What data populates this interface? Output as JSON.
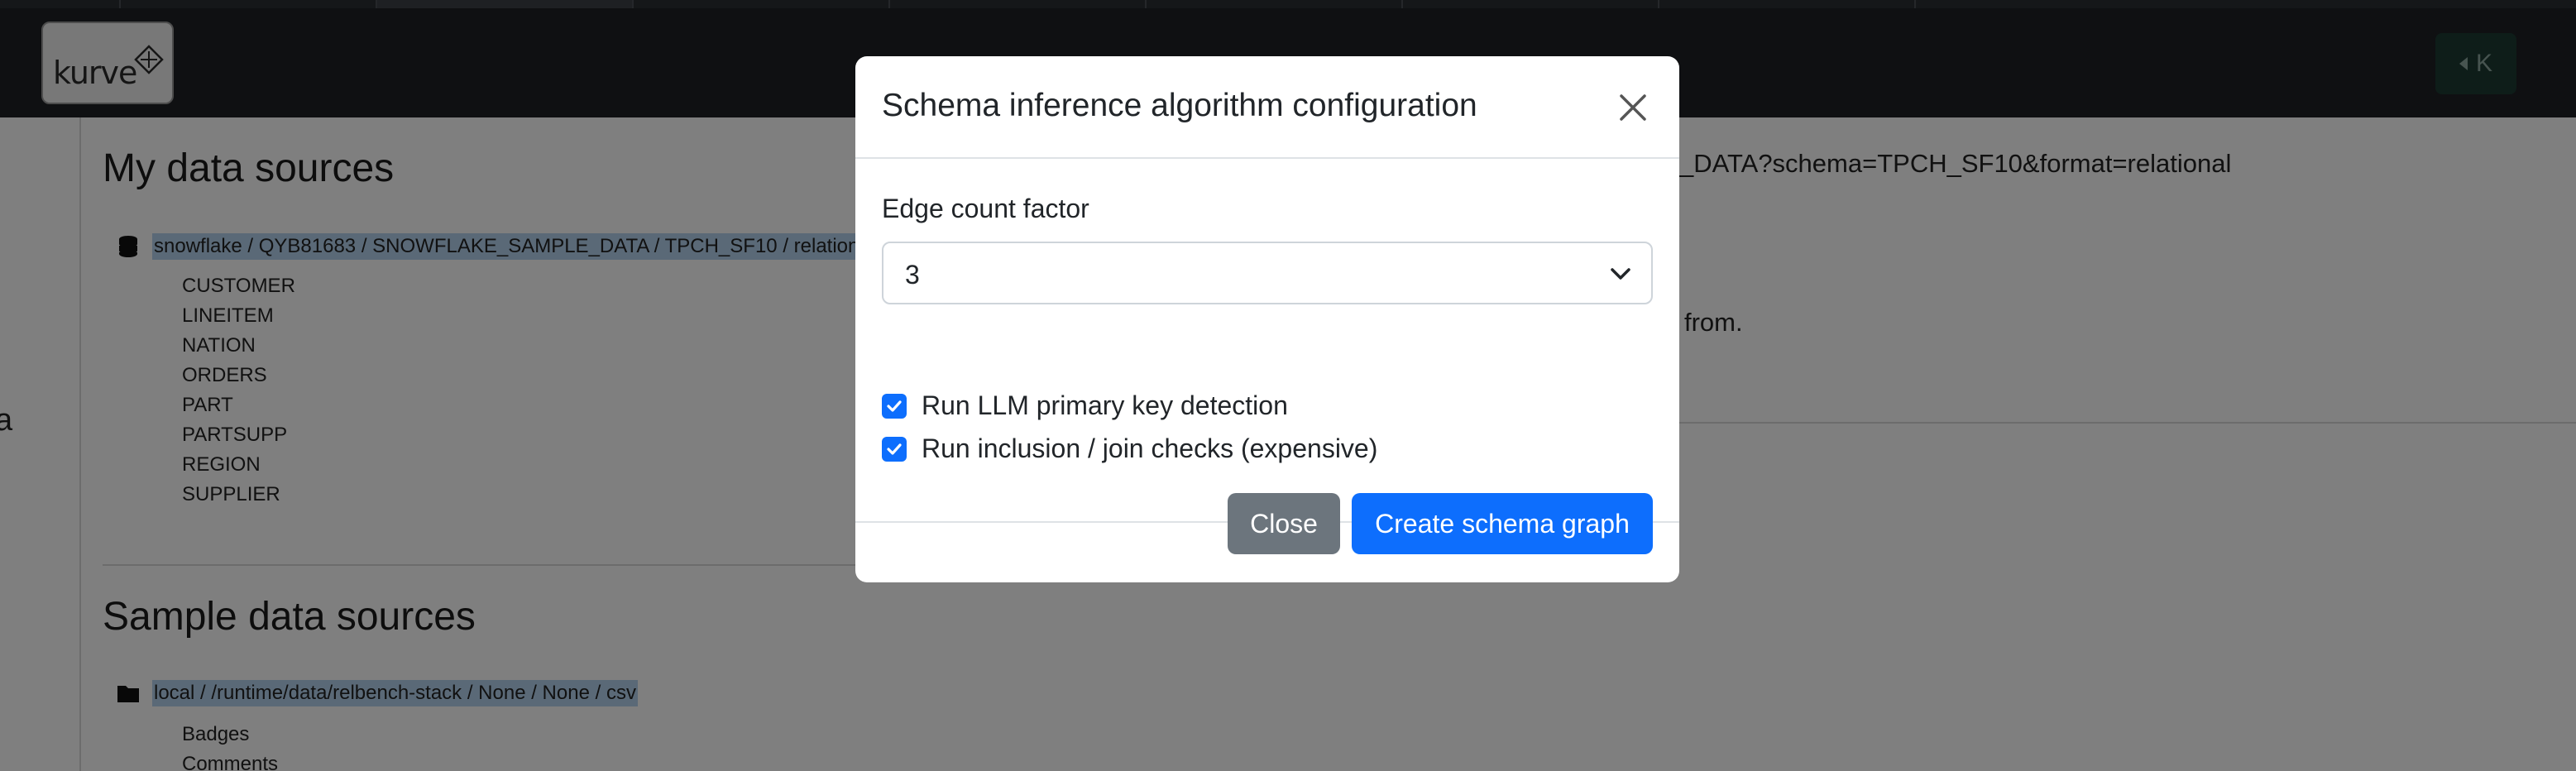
{
  "app": {
    "logo_text": "kurve",
    "side_toggle_label": "K"
  },
  "background": {
    "rail_letter": "a",
    "my_sources": {
      "title": "My data sources",
      "source_label": "snowflake / QYB81683 / SNOWFLAKE_SAMPLE_DATA / TPCH_SF10 / relational",
      "tables": [
        "CUSTOMER",
        "LINEITEM",
        "NATION",
        "ORDERS",
        "PART",
        "PARTSUPP",
        "REGION",
        "SUPPLIER"
      ]
    },
    "sample_sources": {
      "title": "Sample data sources",
      "source_label": "local / /runtime/data/relbench-stack / None / None / csv",
      "tables": [
        "Badges",
        "Comments"
      ]
    },
    "right_text_1": "_DATA?schema=TPCH_SF10&format=relational",
    "right_text_2": "from."
  },
  "modal": {
    "title": "Schema inference algorithm configuration",
    "edge_count_label": "Edge count factor",
    "edge_count_value": "3",
    "options": [
      {
        "label": "Run LLM primary key detection",
        "checked": true
      },
      {
        "label": "Run inclusion / join checks (expensive)",
        "checked": true
      }
    ],
    "close_button": "Close",
    "create_button": "Create schema graph"
  },
  "colors": {
    "primary": "#0d6efd",
    "secondary": "#6c757d",
    "header_bg": "#1e2124",
    "selection_highlight": "#b4d3ee"
  }
}
